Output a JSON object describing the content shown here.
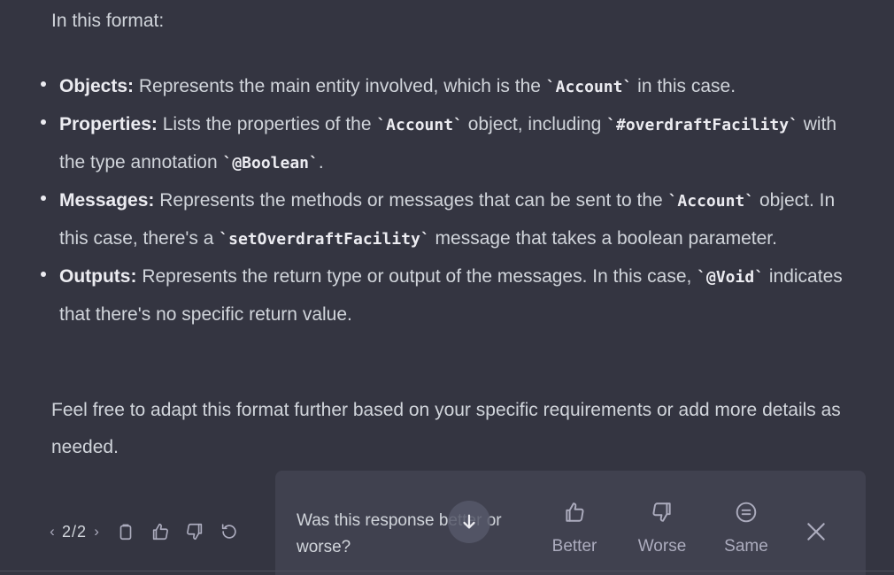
{
  "message": {
    "intro": "In this format:",
    "bullets": [
      {
        "term": "Objects:",
        "parts": [
          {
            "t": "text",
            "v": " Represents the main entity involved, which is the "
          },
          {
            "t": "code",
            "v": "`Account`"
          },
          {
            "t": "text",
            "v": " in this case."
          }
        ]
      },
      {
        "term": "Properties:",
        "parts": [
          {
            "t": "text",
            "v": " Lists the properties of the "
          },
          {
            "t": "code",
            "v": "`Account`"
          },
          {
            "t": "text",
            "v": " object, including "
          },
          {
            "t": "code",
            "v": "`#overdraftFacility`"
          },
          {
            "t": "text",
            "v": " with the type annotation "
          },
          {
            "t": "code",
            "v": "`@Boolean`"
          },
          {
            "t": "text",
            "v": "."
          }
        ]
      },
      {
        "term": "Messages:",
        "parts": [
          {
            "t": "text",
            "v": " Represents the methods or messages that can be sent to the "
          },
          {
            "t": "code",
            "v": "`Account`"
          },
          {
            "t": "text",
            "v": " object. In this case, there's a "
          },
          {
            "t": "code",
            "v": "`setOverdraftFacility`"
          },
          {
            "t": "text",
            "v": " message that takes a boolean parameter."
          }
        ]
      },
      {
        "term": "Outputs:",
        "parts": [
          {
            "t": "text",
            "v": " Represents the return type or output of the messages. In this case, "
          },
          {
            "t": "code",
            "v": "`@Void`"
          },
          {
            "t": "text",
            "v": " indicates that there's no specific return value."
          }
        ]
      }
    ],
    "outro": "Feel free to adapt this format further based on your specific requirements or add more details as needed."
  },
  "pager": {
    "prev": "‹",
    "current": "2/2",
    "next": "›"
  },
  "toolbar_icons": [
    "clipboard-icon",
    "thumbs-up-icon",
    "thumbs-down-icon",
    "regenerate-icon"
  ],
  "feedback": {
    "question": "Was this response better or worse?",
    "better": "Better",
    "worse": "Worse",
    "same": "Same"
  },
  "colors": {
    "background": "#343541",
    "panel": "#40414f",
    "text": "#d1d5db",
    "muted": "#acacbe"
  }
}
